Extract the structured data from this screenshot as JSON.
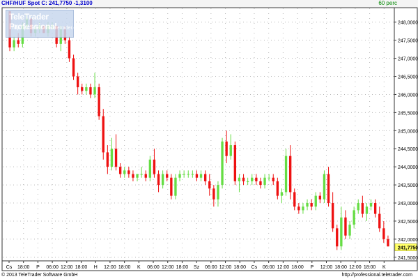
{
  "header": {
    "title": "CHF/HUF Spot  C: 241,7750  -1,3100",
    "period": "60 perc"
  },
  "watermark": {
    "brand": "TeleTrader Professional",
    "url": "http://professional.teletrader.com"
  },
  "footer": {
    "copyright": "© 2013 TeleTrader Software GmbH",
    "url": "http://professional.teletrader.com"
  },
  "colors": {
    "up": "#66dd44",
    "down": "#ee1111",
    "grid": "#b8b8b8",
    "axis": "#333333",
    "last_price_bg": "#ffff66"
  },
  "chart_data": {
    "type": "candlestick",
    "instrument": "CHF/HUF Spot",
    "close": 241.775,
    "change": -1.31,
    "interval": "60 perc",
    "ylim": [
      241.4,
      248.4
    ],
    "y_ticks": [
      "241,5000",
      "242,0000",
      "242,5000",
      "243,0000",
      "243,5000",
      "244,0000",
      "244,5000",
      "245,0000",
      "245,5000",
      "246,0000",
      "246,5000",
      "247,0000",
      "247,5000",
      "248,0000"
    ],
    "last_price_label": "241,7750",
    "x_ticks": [
      "Cs",
      "18:00",
      "P",
      "06:00",
      "12:00",
      "18:00",
      "H",
      "12:00",
      "18:00",
      "K",
      "06:00",
      "12:00",
      "18:00",
      "Sz",
      "06:00",
      "12:00",
      "18:00",
      "Cs",
      "06:00",
      "12:00",
      "18:00",
      "P",
      "12:00",
      "18:00",
      "12:00",
      "18:00",
      "K"
    ],
    "candles": [
      [
        248.3,
        248.3,
        247.2,
        247.3
      ],
      [
        247.3,
        247.6,
        247.2,
        247.5
      ],
      [
        247.5,
        247.7,
        247.3,
        247.4
      ],
      [
        247.4,
        248.0,
        247.3,
        247.9
      ],
      [
        247.9,
        248.2,
        247.8,
        248.1
      ],
      [
        248.1,
        248.1,
        247.6,
        247.7
      ],
      [
        247.7,
        247.9,
        247.6,
        247.8
      ],
      [
        247.8,
        248.0,
        247.7,
        247.9
      ],
      [
        247.9,
        247.9,
        247.7,
        247.7
      ],
      [
        247.7,
        248.0,
        247.6,
        247.9
      ],
      [
        247.9,
        248.0,
        247.8,
        247.9
      ],
      [
        247.9,
        247.9,
        247.3,
        247.4
      ],
      [
        247.4,
        247.9,
        247.2,
        247.8
      ],
      [
        247.8,
        247.9,
        247.4,
        247.5
      ],
      [
        247.5,
        247.6,
        246.9,
        247.0
      ],
      [
        247.0,
        247.1,
        246.4,
        246.5
      ],
      [
        246.5,
        246.6,
        246.0,
        246.2
      ],
      [
        246.2,
        246.3,
        246.0,
        246.1
      ],
      [
        246.1,
        246.3,
        246.0,
        246.2
      ],
      [
        246.2,
        246.3,
        245.9,
        246.0
      ],
      [
        246.0,
        246.6,
        245.9,
        246.2
      ],
      [
        246.2,
        246.3,
        245.3,
        245.4
      ],
      [
        245.4,
        245.6,
        244.2,
        244.4
      ],
      [
        244.4,
        244.6,
        243.8,
        244.0
      ],
      [
        244.0,
        244.8,
        243.9,
        244.5
      ],
      [
        244.5,
        244.9,
        243.9,
        244.0
      ],
      [
        244.0,
        244.1,
        243.7,
        243.8
      ],
      [
        243.8,
        244.0,
        243.7,
        243.9
      ],
      [
        243.9,
        244.0,
        243.7,
        243.8
      ],
      [
        243.8,
        243.9,
        243.6,
        243.7
      ],
      [
        243.7,
        243.8,
        243.6,
        243.8
      ],
      [
        243.8,
        244.0,
        243.7,
        243.8
      ],
      [
        243.8,
        243.9,
        243.6,
        243.7
      ],
      [
        243.7,
        244.3,
        243.6,
        244.2
      ],
      [
        244.2,
        244.5,
        243.7,
        243.8
      ],
      [
        243.8,
        243.9,
        243.3,
        243.5
      ],
      [
        243.5,
        243.9,
        243.4,
        243.8
      ],
      [
        243.8,
        243.9,
        243.6,
        243.7
      ],
      [
        243.7,
        243.8,
        243.1,
        243.2
      ],
      [
        243.2,
        243.8,
        243.1,
        243.7
      ],
      [
        243.7,
        243.9,
        243.6,
        243.8
      ],
      [
        243.8,
        243.9,
        243.7,
        243.8
      ],
      [
        243.8,
        243.9,
        243.7,
        243.8
      ],
      [
        243.8,
        243.9,
        243.7,
        243.8
      ],
      [
        243.8,
        243.9,
        243.6,
        243.7
      ],
      [
        243.7,
        243.9,
        243.6,
        243.8
      ],
      [
        243.8,
        243.9,
        243.5,
        243.6
      ],
      [
        243.6,
        243.8,
        243.2,
        243.4
      ],
      [
        243.4,
        243.5,
        242.9,
        243.1
      ],
      [
        243.1,
        243.6,
        242.9,
        243.5
      ],
      [
        243.5,
        244.8,
        243.4,
        244.7
      ],
      [
        244.7,
        245.0,
        244.1,
        244.3
      ],
      [
        244.3,
        244.9,
        244.2,
        244.6
      ],
      [
        244.6,
        244.7,
        243.5,
        243.6
      ],
      [
        243.6,
        243.8,
        243.3,
        243.7
      ],
      [
        243.7,
        243.8,
        243.5,
        243.6
      ],
      [
        243.6,
        243.7,
        243.5,
        243.6
      ],
      [
        243.6,
        243.8,
        243.5,
        243.7
      ],
      [
        243.7,
        243.8,
        243.5,
        243.6
      ],
      [
        243.6,
        243.7,
        243.4,
        243.5
      ],
      [
        243.5,
        243.8,
        243.4,
        243.7
      ],
      [
        243.7,
        243.8,
        243.6,
        243.7
      ],
      [
        243.7,
        243.8,
        243.5,
        243.6
      ],
      [
        243.6,
        243.7,
        243.1,
        243.2
      ],
      [
        243.2,
        243.4,
        243.0,
        243.3
      ],
      [
        243.3,
        244.5,
        243.2,
        244.3
      ],
      [
        244.3,
        244.6,
        243.1,
        243.3
      ],
      [
        243.3,
        243.4,
        242.8,
        242.9
      ],
      [
        242.9,
        243.0,
        242.7,
        242.8
      ],
      [
        242.8,
        243.0,
        242.7,
        242.9
      ],
      [
        242.9,
        243.1,
        242.8,
        243.0
      ],
      [
        243.0,
        243.1,
        242.8,
        242.9
      ],
      [
        242.9,
        243.3,
        242.8,
        243.2
      ],
      [
        243.2,
        243.3,
        243.0,
        243.1
      ],
      [
        243.1,
        243.9,
        243.0,
        243.8
      ],
      [
        243.8,
        244.0,
        242.9,
        243.0
      ],
      [
        243.0,
        243.3,
        242.2,
        242.3
      ],
      [
        242.3,
        242.4,
        241.7,
        241.8
      ],
      [
        241.8,
        242.9,
        241.7,
        242.6
      ],
      [
        242.6,
        242.8,
        242.0,
        242.1
      ],
      [
        242.1,
        242.5,
        242.0,
        242.4
      ],
      [
        242.4,
        242.9,
        242.3,
        242.8
      ],
      [
        242.8,
        243.1,
        242.7,
        243.0
      ],
      [
        243.0,
        243.2,
        242.6,
        242.7
      ],
      [
        242.7,
        243.0,
        242.5,
        242.9
      ],
      [
        242.9,
        243.1,
        242.8,
        243.0
      ],
      [
        243.0,
        243.1,
        242.6,
        242.7
      ],
      [
        242.7,
        242.9,
        242.2,
        242.3
      ],
      [
        242.3,
        242.5,
        241.9,
        242.0
      ],
      [
        242.0,
        242.1,
        241.8,
        241.8
      ]
    ]
  }
}
